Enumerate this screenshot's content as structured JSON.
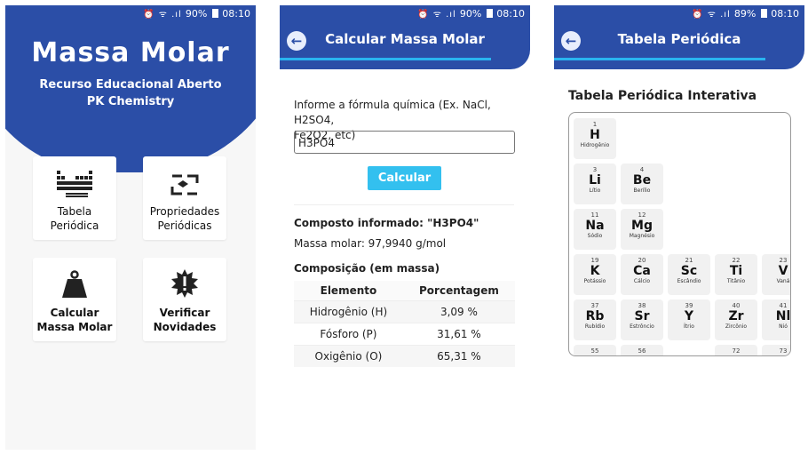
{
  "status": {
    "icons": "⏰ ᯤ .ıl",
    "battery1": "90%",
    "battery2": "90%",
    "battery3": "89%",
    "time": "08:10"
  },
  "home": {
    "title": "Massa Molar",
    "subtitle1": "Recurso Educacional Aberto",
    "subtitle2": "PK Chemistry",
    "tiles": [
      {
        "line1": "Tabela",
        "line2": "Periódica"
      },
      {
        "line1": "Propriedades",
        "line2": "Periódicas"
      },
      {
        "line1": "Calcular",
        "line2": "Massa Molar"
      },
      {
        "line1": "Verificar",
        "line2": "Novidades"
      }
    ]
  },
  "calc": {
    "title": "Calcular Massa Molar",
    "prompt1": "Informe a fórmula química (Ex. NaCl, H2SO4,",
    "prompt2": "Fe2O2, etc)",
    "input_value": "H3PO4",
    "button": "Calcular",
    "compound": "Composto informado: \"H3PO4\"",
    "molar_mass": "Massa molar: 97,9940 g/mol",
    "composition_title": "Composição (em massa)",
    "table_headers": [
      "Elemento",
      "Porcentagem"
    ],
    "rows": [
      [
        "Hidrogênio (H)",
        "3,09 %"
      ],
      [
        "Fósforo (P)",
        "31,61 %"
      ],
      [
        "Oxigênio (O)",
        "65,31 %"
      ]
    ]
  },
  "periodic": {
    "title": "Tabela Periódica",
    "subtitle": "Tabela Periódica Interativa",
    "cells": [
      [
        "1",
        "H",
        "Hidrogênio"
      ],
      [
        "3",
        "Li",
        "Lítio"
      ],
      [
        "4",
        "Be",
        "Berílio"
      ],
      [
        "11",
        "Na",
        "Sódio"
      ],
      [
        "12",
        "Mg",
        "Magnésio"
      ],
      [
        "19",
        "K",
        "Potássio"
      ],
      [
        "20",
        "Ca",
        "Cálcio"
      ],
      [
        "21",
        "Sc",
        "Escândio"
      ],
      [
        "22",
        "Ti",
        "Titânio"
      ],
      [
        "23",
        "V",
        "Vaná"
      ],
      [
        "37",
        "Rb",
        "Rubídio"
      ],
      [
        "38",
        "Sr",
        "Estrôncio"
      ],
      [
        "39",
        "Y",
        "Ítrio"
      ],
      [
        "40",
        "Zr",
        "Zircônio"
      ],
      [
        "41",
        "Nl",
        "Nió"
      ],
      [
        "55",
        "",
        ""
      ],
      [
        "56",
        "",
        ""
      ],
      [
        "72",
        "",
        ""
      ],
      [
        "73",
        "",
        ""
      ]
    ]
  }
}
